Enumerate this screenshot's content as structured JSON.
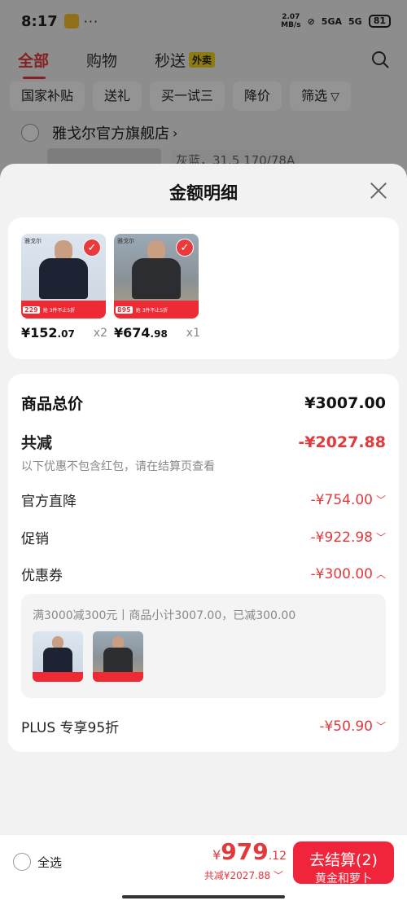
{
  "status_bar": {
    "time": "8:17",
    "dots": "···",
    "speed_top": "2.07",
    "speed_bottom": "MB/s",
    "network1": "5GA",
    "network2": "5G",
    "battery": "81"
  },
  "top_tabs": [
    {
      "label": "全部"
    },
    {
      "label": "购物"
    },
    {
      "label": "秒送",
      "badge": "外卖"
    }
  ],
  "filters": [
    "国家补贴",
    "送礼",
    "买一试三",
    "降价",
    "筛选"
  ],
  "shop": {
    "name": "雅戈尔官方旗舰店",
    "variant": "灰蓝，31.5 170/78A"
  },
  "sheet": {
    "title": "金额明细",
    "products": [
      {
        "price_int": "¥152",
        "price_dec": ".07",
        "qty": "x2",
        "promo_price": "229",
        "promo_text": "抢 3件不止5折"
      },
      {
        "price_int": "¥674",
        "price_dec": ".98",
        "qty": "x1",
        "promo_price": "895",
        "promo_text": "抢 3件不止5折"
      }
    ],
    "total_label": "商品总价",
    "total_value": "¥3007.00",
    "reduce_label": "共减",
    "reduce_value": "-¥2027.88",
    "note": "以下优惠不包含红包，请在结算页查看",
    "lines": [
      {
        "label": "官方直降",
        "value": "-¥754.00"
      },
      {
        "label": "促销",
        "value": "-¥922.98"
      },
      {
        "label": "优惠券",
        "value": "-¥300.00"
      }
    ],
    "coupon_text": "满3000减300元丨商品小计3007.00，已减300.00",
    "plus_label": "PLUS 专享95折",
    "plus_value": "-¥50.90"
  },
  "bottom": {
    "select_all": "全选",
    "yuan": "¥",
    "pay_int": "979",
    "pay_dec": ".12",
    "pay_sub": "共减¥2027.88",
    "checkout": "去结算(2)",
    "checkout_sub": "黄金和萝卜"
  },
  "colors": {
    "accent": "#e4393c",
    "button": "#f0243a",
    "badge": "#f3d41b"
  }
}
